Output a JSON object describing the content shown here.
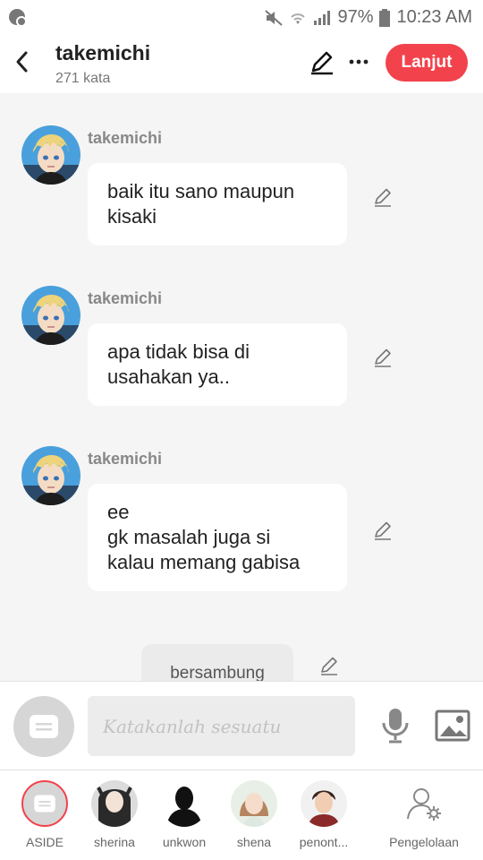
{
  "status_bar": {
    "battery": "97%",
    "time": "10:23 AM"
  },
  "header": {
    "title": "takemichi",
    "word_count": "271 kata",
    "next_label": "Lanjut"
  },
  "messages": [
    {
      "sender": "takemichi",
      "lines": [
        "baik itu sano maupun",
        "kisaki"
      ]
    },
    {
      "sender": "takemichi",
      "lines": [
        "apa tidak bisa di",
        "usahakan ya.."
      ]
    },
    {
      "sender": "takemichi",
      "lines": [
        "ee",
        "gk masalah juga si",
        "kalau memang gabisa"
      ]
    }
  ],
  "continued_label": "bersambung",
  "composer": {
    "placeholder": "Katakanlah sesuatu"
  },
  "cast": [
    {
      "name": "ASIDE"
    },
    {
      "name": "sherina"
    },
    {
      "name": "unkwon"
    },
    {
      "name": "shena"
    },
    {
      "name": "penont..."
    },
    {
      "name": "Pengelolaan"
    }
  ],
  "colors": {
    "accent": "#f2424b",
    "bubble": "#ffffff",
    "background": "#f5f5f5"
  }
}
